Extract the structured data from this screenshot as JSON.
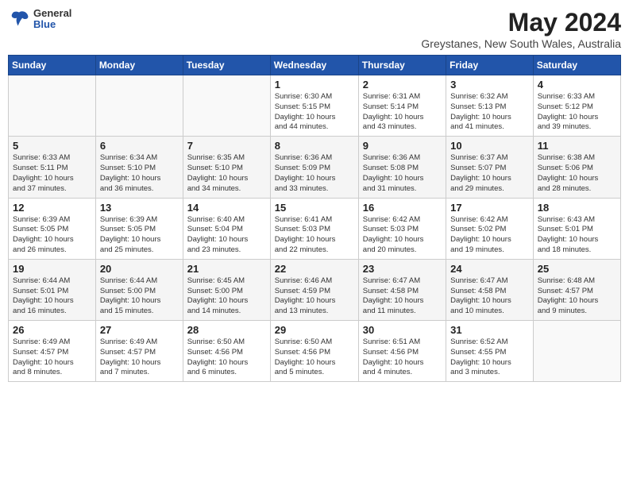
{
  "logo": {
    "general": "General",
    "blue": "Blue"
  },
  "title": {
    "month_year": "May 2024",
    "location": "Greystanes, New South Wales, Australia"
  },
  "weekdays": [
    "Sunday",
    "Monday",
    "Tuesday",
    "Wednesday",
    "Thursday",
    "Friday",
    "Saturday"
  ],
  "weeks": [
    [
      {
        "day": "",
        "info": ""
      },
      {
        "day": "",
        "info": ""
      },
      {
        "day": "",
        "info": ""
      },
      {
        "day": "1",
        "info": "Sunrise: 6:30 AM\nSunset: 5:15 PM\nDaylight: 10 hours\nand 44 minutes."
      },
      {
        "day": "2",
        "info": "Sunrise: 6:31 AM\nSunset: 5:14 PM\nDaylight: 10 hours\nand 43 minutes."
      },
      {
        "day": "3",
        "info": "Sunrise: 6:32 AM\nSunset: 5:13 PM\nDaylight: 10 hours\nand 41 minutes."
      },
      {
        "day": "4",
        "info": "Sunrise: 6:33 AM\nSunset: 5:12 PM\nDaylight: 10 hours\nand 39 minutes."
      }
    ],
    [
      {
        "day": "5",
        "info": "Sunrise: 6:33 AM\nSunset: 5:11 PM\nDaylight: 10 hours\nand 37 minutes."
      },
      {
        "day": "6",
        "info": "Sunrise: 6:34 AM\nSunset: 5:10 PM\nDaylight: 10 hours\nand 36 minutes."
      },
      {
        "day": "7",
        "info": "Sunrise: 6:35 AM\nSunset: 5:10 PM\nDaylight: 10 hours\nand 34 minutes."
      },
      {
        "day": "8",
        "info": "Sunrise: 6:36 AM\nSunset: 5:09 PM\nDaylight: 10 hours\nand 33 minutes."
      },
      {
        "day": "9",
        "info": "Sunrise: 6:36 AM\nSunset: 5:08 PM\nDaylight: 10 hours\nand 31 minutes."
      },
      {
        "day": "10",
        "info": "Sunrise: 6:37 AM\nSunset: 5:07 PM\nDaylight: 10 hours\nand 29 minutes."
      },
      {
        "day": "11",
        "info": "Sunrise: 6:38 AM\nSunset: 5:06 PM\nDaylight: 10 hours\nand 28 minutes."
      }
    ],
    [
      {
        "day": "12",
        "info": "Sunrise: 6:39 AM\nSunset: 5:05 PM\nDaylight: 10 hours\nand 26 minutes."
      },
      {
        "day": "13",
        "info": "Sunrise: 6:39 AM\nSunset: 5:05 PM\nDaylight: 10 hours\nand 25 minutes."
      },
      {
        "day": "14",
        "info": "Sunrise: 6:40 AM\nSunset: 5:04 PM\nDaylight: 10 hours\nand 23 minutes."
      },
      {
        "day": "15",
        "info": "Sunrise: 6:41 AM\nSunset: 5:03 PM\nDaylight: 10 hours\nand 22 minutes."
      },
      {
        "day": "16",
        "info": "Sunrise: 6:42 AM\nSunset: 5:03 PM\nDaylight: 10 hours\nand 20 minutes."
      },
      {
        "day": "17",
        "info": "Sunrise: 6:42 AM\nSunset: 5:02 PM\nDaylight: 10 hours\nand 19 minutes."
      },
      {
        "day": "18",
        "info": "Sunrise: 6:43 AM\nSunset: 5:01 PM\nDaylight: 10 hours\nand 18 minutes."
      }
    ],
    [
      {
        "day": "19",
        "info": "Sunrise: 6:44 AM\nSunset: 5:01 PM\nDaylight: 10 hours\nand 16 minutes."
      },
      {
        "day": "20",
        "info": "Sunrise: 6:44 AM\nSunset: 5:00 PM\nDaylight: 10 hours\nand 15 minutes."
      },
      {
        "day": "21",
        "info": "Sunrise: 6:45 AM\nSunset: 5:00 PM\nDaylight: 10 hours\nand 14 minutes."
      },
      {
        "day": "22",
        "info": "Sunrise: 6:46 AM\nSunset: 4:59 PM\nDaylight: 10 hours\nand 13 minutes."
      },
      {
        "day": "23",
        "info": "Sunrise: 6:47 AM\nSunset: 4:58 PM\nDaylight: 10 hours\nand 11 minutes."
      },
      {
        "day": "24",
        "info": "Sunrise: 6:47 AM\nSunset: 4:58 PM\nDaylight: 10 hours\nand 10 minutes."
      },
      {
        "day": "25",
        "info": "Sunrise: 6:48 AM\nSunset: 4:57 PM\nDaylight: 10 hours\nand 9 minutes."
      }
    ],
    [
      {
        "day": "26",
        "info": "Sunrise: 6:49 AM\nSunset: 4:57 PM\nDaylight: 10 hours\nand 8 minutes."
      },
      {
        "day": "27",
        "info": "Sunrise: 6:49 AM\nSunset: 4:57 PM\nDaylight: 10 hours\nand 7 minutes."
      },
      {
        "day": "28",
        "info": "Sunrise: 6:50 AM\nSunset: 4:56 PM\nDaylight: 10 hours\nand 6 minutes."
      },
      {
        "day": "29",
        "info": "Sunrise: 6:50 AM\nSunset: 4:56 PM\nDaylight: 10 hours\nand 5 minutes."
      },
      {
        "day": "30",
        "info": "Sunrise: 6:51 AM\nSunset: 4:56 PM\nDaylight: 10 hours\nand 4 minutes."
      },
      {
        "day": "31",
        "info": "Sunrise: 6:52 AM\nSunset: 4:55 PM\nDaylight: 10 hours\nand 3 minutes."
      },
      {
        "day": "",
        "info": ""
      }
    ]
  ]
}
